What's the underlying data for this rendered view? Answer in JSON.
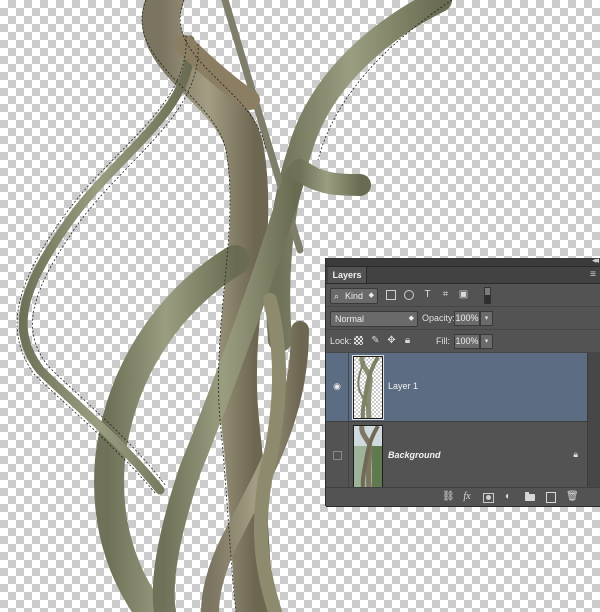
{
  "panel": {
    "tab_label": "Layers",
    "filter": {
      "kind_label": "Kind"
    },
    "blend_mode": "Normal",
    "opacity_label": "Opacity:",
    "opacity_value": "100%",
    "lock_label": "Lock:",
    "fill_label": "Fill:",
    "fill_value": "100%",
    "layers": [
      {
        "name": "Layer 1",
        "visible": true,
        "selected": true
      },
      {
        "name": "Background",
        "visible": false,
        "selected": false,
        "locked": true
      }
    ]
  },
  "colors": {
    "panel_bg": "#535353",
    "selection": "#5c6c82",
    "branch": "#8a8f6e"
  }
}
